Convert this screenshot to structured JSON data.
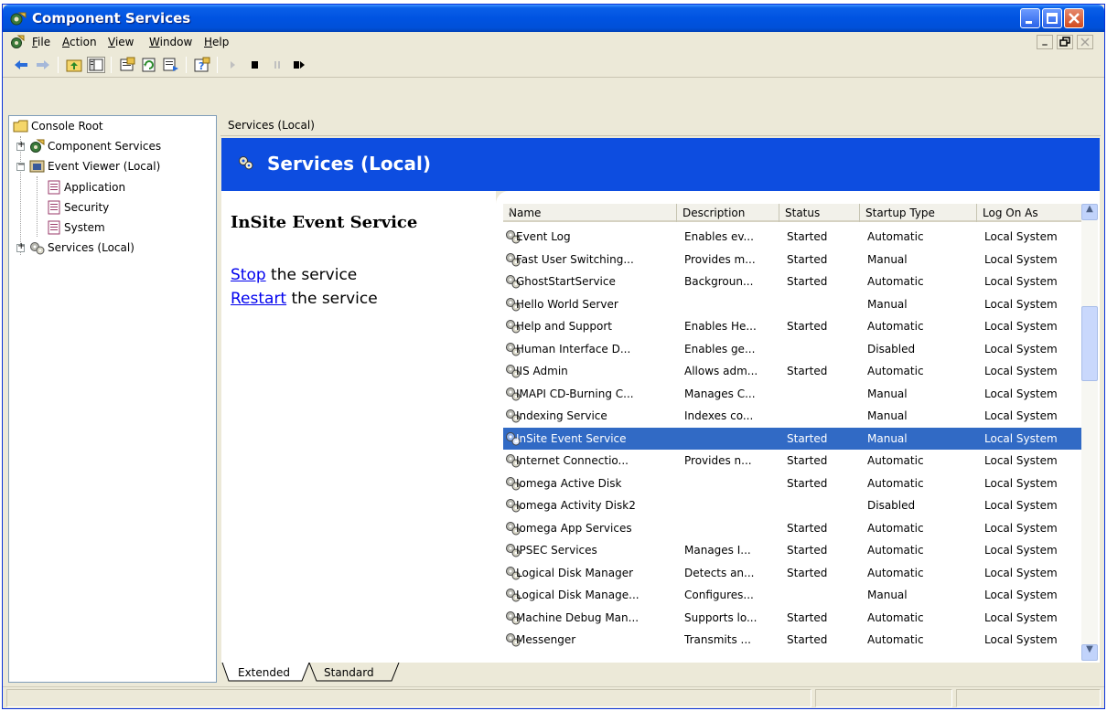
{
  "window": {
    "title": "Component Services"
  },
  "menubar": {
    "items": [
      "File",
      "Action",
      "View",
      "Window",
      "Help"
    ]
  },
  "tree": {
    "root": "Console Root",
    "items": [
      {
        "label": "Component Services"
      },
      {
        "label": "Event Viewer (Local)"
      },
      {
        "label": "Application"
      },
      {
        "label": "Security"
      },
      {
        "label": "System"
      },
      {
        "label": "Services (Local)"
      }
    ]
  },
  "right": {
    "header": "Services (Local)",
    "banner_title": "Services (Local)"
  },
  "description": {
    "service_name": "InSite Event Service",
    "stop_link": "Stop",
    "stop_suffix": " the service",
    "restart_link": "Restart",
    "restart_suffix": " the service"
  },
  "list": {
    "columns": [
      "Name",
      "Description",
      "Status",
      "Startup Type",
      "Log On As"
    ],
    "sort_arrow": "/",
    "rows": [
      {
        "name": "Event Log",
        "description": "Enables ev...",
        "status": "Started",
        "startup": "Automatic",
        "logon": "Local System"
      },
      {
        "name": "Fast User Switching...",
        "description": "Provides m...",
        "status": "Started",
        "startup": "Manual",
        "logon": "Local System"
      },
      {
        "name": "GhostStartService",
        "description": "Backgroun...",
        "status": "Started",
        "startup": "Automatic",
        "logon": "Local System"
      },
      {
        "name": "Hello World Server",
        "description": "",
        "status": "",
        "startup": "Manual",
        "logon": "Local System"
      },
      {
        "name": "Help and Support",
        "description": "Enables He...",
        "status": "Started",
        "startup": "Automatic",
        "logon": "Local System"
      },
      {
        "name": "Human Interface D...",
        "description": "Enables ge...",
        "status": "",
        "startup": "Disabled",
        "logon": "Local System"
      },
      {
        "name": "IIS Admin",
        "description": "Allows adm...",
        "status": "Started",
        "startup": "Automatic",
        "logon": "Local System"
      },
      {
        "name": "IMAPI CD-Burning C...",
        "description": "Manages C...",
        "status": "",
        "startup": "Manual",
        "logon": "Local System"
      },
      {
        "name": "Indexing Service",
        "description": "Indexes co...",
        "status": "",
        "startup": "Manual",
        "logon": "Local System"
      },
      {
        "name": "InSite Event Service",
        "description": "",
        "status": "Started",
        "startup": "Manual",
        "logon": "Local System"
      },
      {
        "name": "Internet Connectio...",
        "description": "Provides n...",
        "status": "Started",
        "startup": "Automatic",
        "logon": "Local System"
      },
      {
        "name": "Iomega Active Disk",
        "description": "",
        "status": "Started",
        "startup": "Automatic",
        "logon": "Local System"
      },
      {
        "name": "Iomega Activity Disk2",
        "description": "",
        "status": "",
        "startup": "Disabled",
        "logon": "Local System"
      },
      {
        "name": "Iomega App Services",
        "description": "",
        "status": "Started",
        "startup": "Automatic",
        "logon": "Local System"
      },
      {
        "name": "IPSEC Services",
        "description": "Manages I...",
        "status": "Started",
        "startup": "Automatic",
        "logon": "Local System"
      },
      {
        "name": "Logical Disk Manager",
        "description": "Detects an...",
        "status": "Started",
        "startup": "Automatic",
        "logon": "Local System"
      },
      {
        "name": "Logical Disk Manage...",
        "description": "Configures...",
        "status": "",
        "startup": "Manual",
        "logon": "Local System"
      },
      {
        "name": "Machine Debug Man...",
        "description": "Supports lo...",
        "status": "Started",
        "startup": "Automatic",
        "logon": "Local System"
      },
      {
        "name": "Messenger",
        "description": "Transmits ...",
        "status": "Started",
        "startup": "Automatic",
        "logon": "Local System"
      }
    ]
  },
  "tabs": [
    "Extended",
    "Standard"
  ],
  "colors": {
    "title_bar": "#0053e1",
    "banner": "#0d4de0",
    "selection": "#316ac5",
    "link": "#0000ee"
  }
}
